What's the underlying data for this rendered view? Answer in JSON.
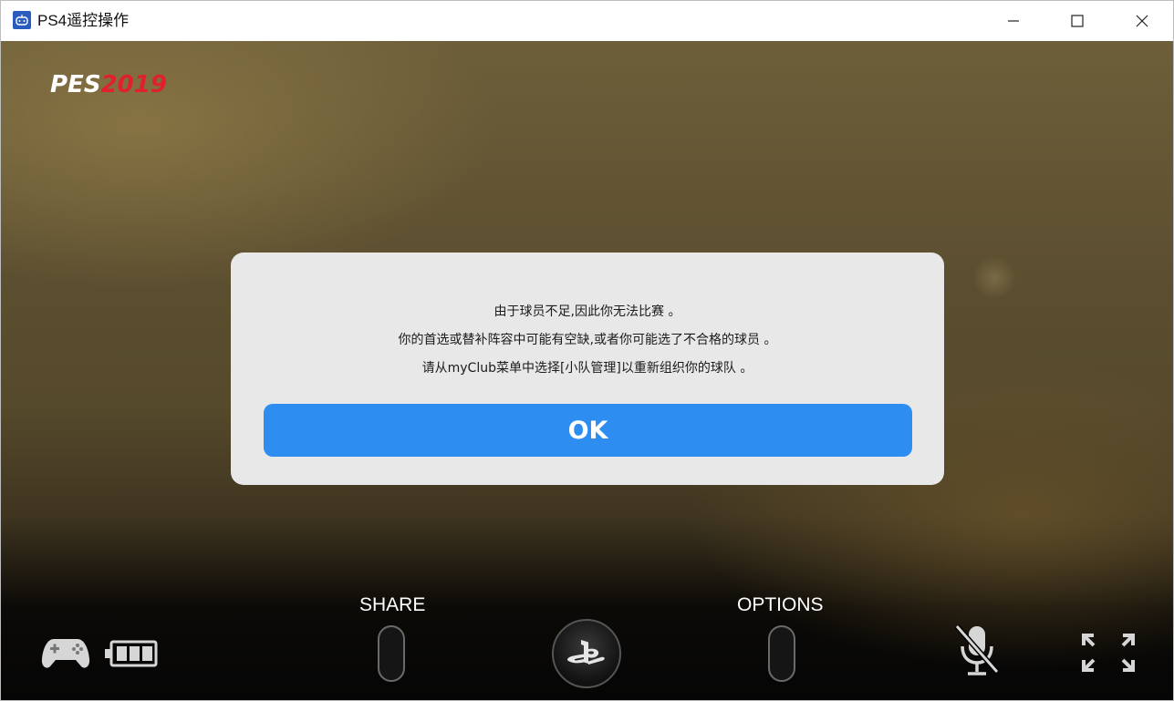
{
  "window": {
    "title": "PS4遥控操作",
    "app_icon": "ps4-remote-icon",
    "controls": [
      "minimize-icon",
      "maximize-icon",
      "close-icon"
    ]
  },
  "game": {
    "logo": {
      "pes": "PES",
      "year": "2019"
    },
    "dialog": {
      "lines": [
        "由于球员不足,因此你无法比赛 。",
        "你的首选或替补阵容中可能有空缺,或者你可能选了不合格的球员 。",
        "请从myClub菜单中选择[小队管理]以重新组织你的球队 。"
      ],
      "ok_label": "OK"
    }
  },
  "controls_bar": {
    "share_label": "SHARE",
    "options_label": "OPTIONS",
    "battery_level": 1.0,
    "icons": [
      "gamepad-icon",
      "battery-icon",
      "playstation-icon",
      "mic-muted-icon",
      "fullscreen-icon"
    ]
  },
  "colors": {
    "ok_button": "#2d8df0",
    "logo_red": "#e0212b",
    "dialog_bg": "#e8e8e8"
  }
}
